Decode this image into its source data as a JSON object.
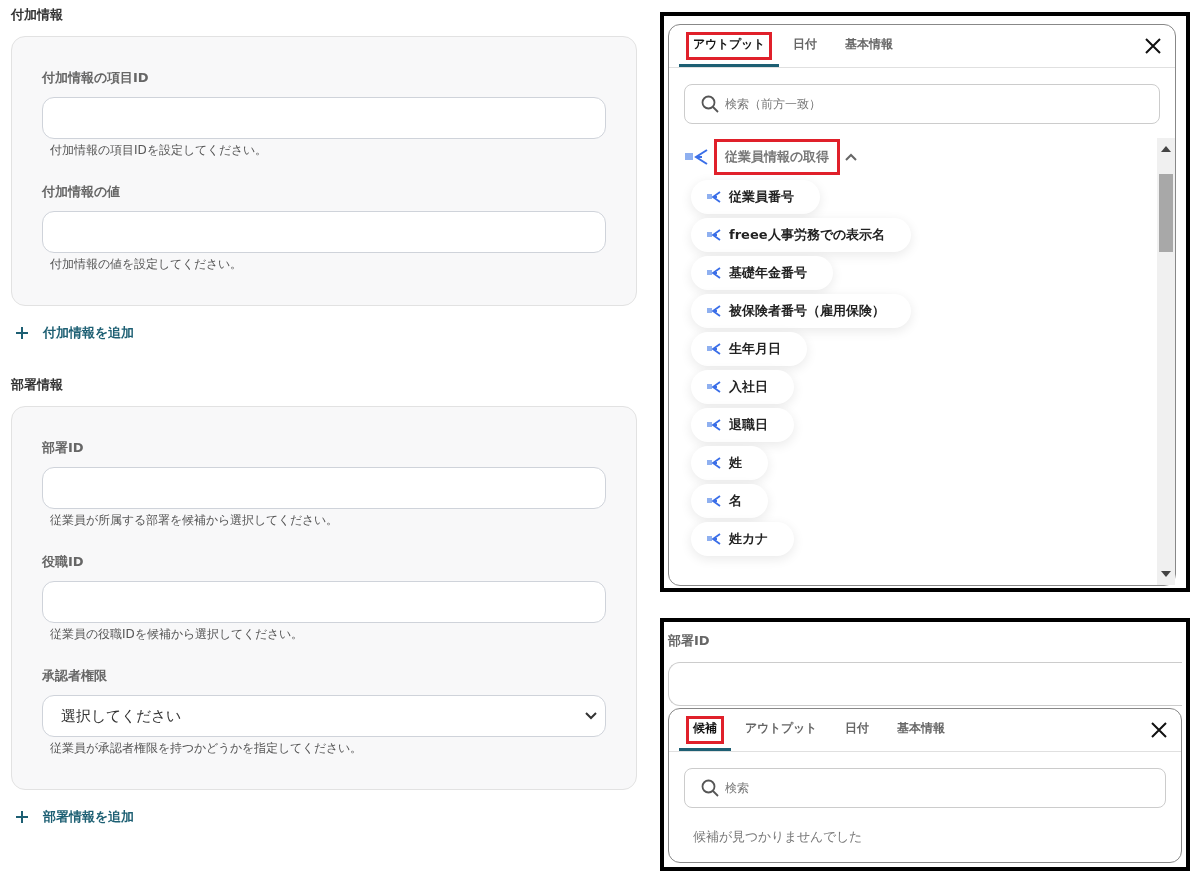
{
  "form": {
    "sections": [
      {
        "title": "付加情報",
        "fields": [
          {
            "kind": "text",
            "label": "付加情報の項目ID",
            "help": "付加情報の項目IDを設定してください。"
          },
          {
            "kind": "text",
            "label": "付加情報の値",
            "help": "付加情報の値を設定してください。"
          }
        ],
        "add_link": "付加情報を追加"
      },
      {
        "title": "部署情報",
        "fields": [
          {
            "kind": "text",
            "label": "部署ID",
            "help": "従業員が所属する部署を候補から選択してください。"
          },
          {
            "kind": "text",
            "label": "役職ID",
            "help": "従業員の役職IDを候補から選択してください。"
          },
          {
            "kind": "select",
            "label": "承認者権限",
            "value": "選択してください",
            "help": "従業員が承認者権限を持つかどうかを指定してください。"
          }
        ],
        "add_link": "部署情報を追加"
      }
    ]
  },
  "output_panel": {
    "tabs": [
      {
        "label": "アウトプット",
        "selected": true,
        "highlighted": true
      },
      {
        "label": "日付",
        "selected": false,
        "highlighted": false
      },
      {
        "label": "基本情報",
        "selected": false,
        "highlighted": false
      }
    ],
    "search": {
      "placeholder": "検索（前方一致）"
    },
    "group": {
      "title": "従業員情報の取得",
      "expanded": true,
      "highlighted": true,
      "items": [
        "従業員番号",
        "freee人事労務での表示名",
        "基礎年金番号",
        "被保険者番号（雇用保険）",
        "生年月日",
        "入社日",
        "退職日",
        "姓",
        "名",
        "姓カナ"
      ]
    }
  },
  "candidate_panel": {
    "field_label": "部署ID",
    "tabs": [
      {
        "label": "候補",
        "selected": true,
        "highlighted": true
      },
      {
        "label": "アウトプット",
        "selected": false,
        "highlighted": false
      },
      {
        "label": "日付",
        "selected": false,
        "highlighted": false
      },
      {
        "label": "基本情報",
        "selected": false,
        "highlighted": false
      }
    ],
    "search": {
      "placeholder": "検索"
    },
    "empty_message": "候補が見つかりませんでした"
  }
}
